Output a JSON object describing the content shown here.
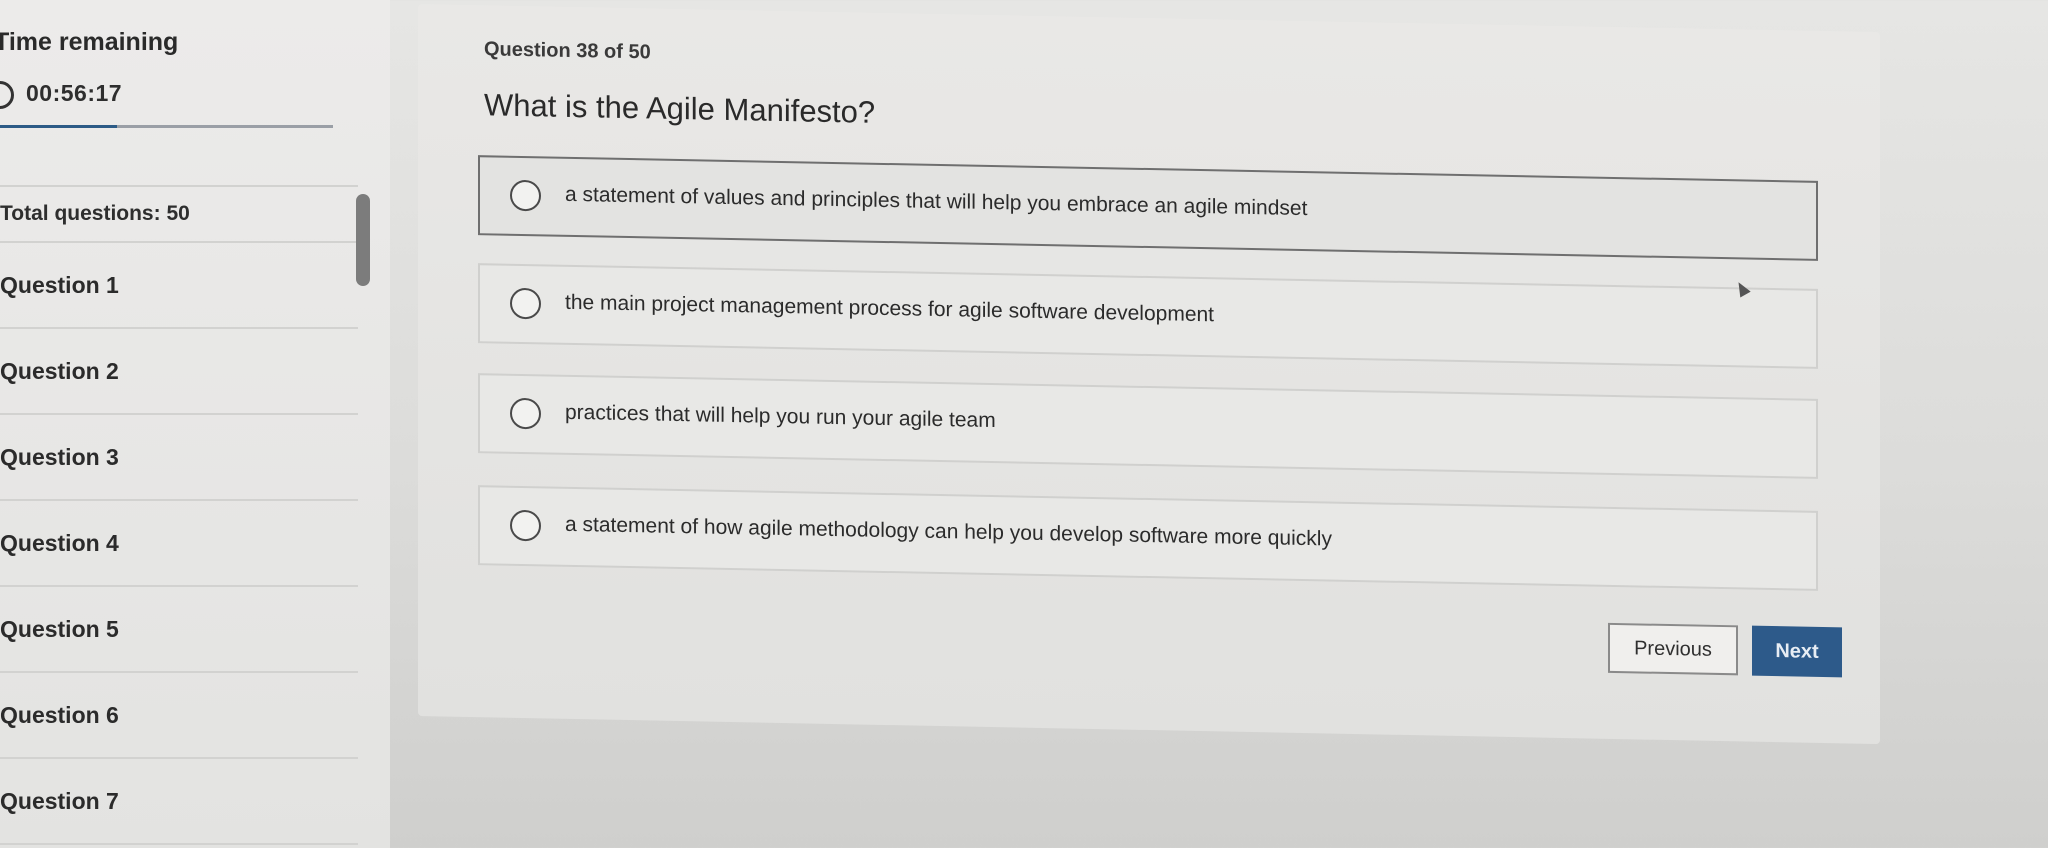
{
  "sidebar": {
    "timer_label": "Time remaining",
    "timer_value": "00:56:17",
    "timer_progress": 0.35,
    "total_questions": "Total questions: 50",
    "questions": [
      {
        "label": "Question 1"
      },
      {
        "label": "Question 2"
      },
      {
        "label": "Question 3"
      },
      {
        "label": "Question 4"
      },
      {
        "label": "Question 5"
      },
      {
        "label": "Question 6"
      },
      {
        "label": "Question 7"
      }
    ]
  },
  "main": {
    "counter": "Question 38 of 50",
    "question": "What is the Agile Manifesto?",
    "options": [
      {
        "label": "a statement of values and principles that will help you embrace an agile mindset"
      },
      {
        "label": "the main project management process for agile software development"
      },
      {
        "label": "practices that will help you run your agile team"
      },
      {
        "label": "a statement of how agile methodology can help you develop software more quickly"
      }
    ],
    "previous_label": "Previous",
    "next_label": "Next"
  },
  "colors": {
    "accent": "#2d5a8a",
    "timer_bar": "#2c5b86"
  },
  "icons": {
    "timer": "clock-icon",
    "option_marker": "radio-circle-icon",
    "pointer": "mouse-cursor-icon"
  }
}
